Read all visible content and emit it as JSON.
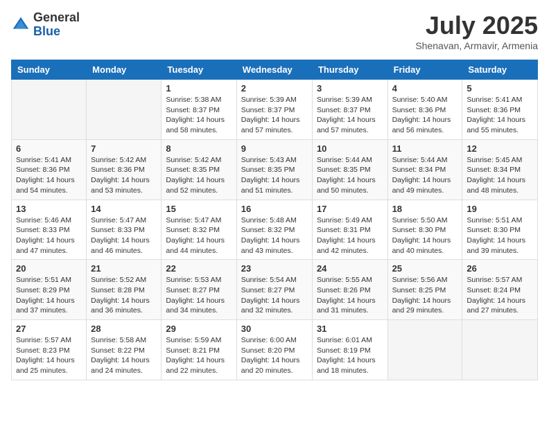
{
  "header": {
    "logo_general": "General",
    "logo_blue": "Blue",
    "title": "July 2025",
    "location": "Shenavan, Armavir, Armenia"
  },
  "calendar": {
    "headers": [
      "Sunday",
      "Monday",
      "Tuesday",
      "Wednesday",
      "Thursday",
      "Friday",
      "Saturday"
    ],
    "weeks": [
      [
        {
          "day": "",
          "info": ""
        },
        {
          "day": "",
          "info": ""
        },
        {
          "day": "1",
          "info": "Sunrise: 5:38 AM\nSunset: 8:37 PM\nDaylight: 14 hours and 58 minutes."
        },
        {
          "day": "2",
          "info": "Sunrise: 5:39 AM\nSunset: 8:37 PM\nDaylight: 14 hours and 57 minutes."
        },
        {
          "day": "3",
          "info": "Sunrise: 5:39 AM\nSunset: 8:37 PM\nDaylight: 14 hours and 57 minutes."
        },
        {
          "day": "4",
          "info": "Sunrise: 5:40 AM\nSunset: 8:36 PM\nDaylight: 14 hours and 56 minutes."
        },
        {
          "day": "5",
          "info": "Sunrise: 5:41 AM\nSunset: 8:36 PM\nDaylight: 14 hours and 55 minutes."
        }
      ],
      [
        {
          "day": "6",
          "info": "Sunrise: 5:41 AM\nSunset: 8:36 PM\nDaylight: 14 hours and 54 minutes."
        },
        {
          "day": "7",
          "info": "Sunrise: 5:42 AM\nSunset: 8:36 PM\nDaylight: 14 hours and 53 minutes."
        },
        {
          "day": "8",
          "info": "Sunrise: 5:42 AM\nSunset: 8:35 PM\nDaylight: 14 hours and 52 minutes."
        },
        {
          "day": "9",
          "info": "Sunrise: 5:43 AM\nSunset: 8:35 PM\nDaylight: 14 hours and 51 minutes."
        },
        {
          "day": "10",
          "info": "Sunrise: 5:44 AM\nSunset: 8:35 PM\nDaylight: 14 hours and 50 minutes."
        },
        {
          "day": "11",
          "info": "Sunrise: 5:44 AM\nSunset: 8:34 PM\nDaylight: 14 hours and 49 minutes."
        },
        {
          "day": "12",
          "info": "Sunrise: 5:45 AM\nSunset: 8:34 PM\nDaylight: 14 hours and 48 minutes."
        }
      ],
      [
        {
          "day": "13",
          "info": "Sunrise: 5:46 AM\nSunset: 8:33 PM\nDaylight: 14 hours and 47 minutes."
        },
        {
          "day": "14",
          "info": "Sunrise: 5:47 AM\nSunset: 8:33 PM\nDaylight: 14 hours and 46 minutes."
        },
        {
          "day": "15",
          "info": "Sunrise: 5:47 AM\nSunset: 8:32 PM\nDaylight: 14 hours and 44 minutes."
        },
        {
          "day": "16",
          "info": "Sunrise: 5:48 AM\nSunset: 8:32 PM\nDaylight: 14 hours and 43 minutes."
        },
        {
          "day": "17",
          "info": "Sunrise: 5:49 AM\nSunset: 8:31 PM\nDaylight: 14 hours and 42 minutes."
        },
        {
          "day": "18",
          "info": "Sunrise: 5:50 AM\nSunset: 8:30 PM\nDaylight: 14 hours and 40 minutes."
        },
        {
          "day": "19",
          "info": "Sunrise: 5:51 AM\nSunset: 8:30 PM\nDaylight: 14 hours and 39 minutes."
        }
      ],
      [
        {
          "day": "20",
          "info": "Sunrise: 5:51 AM\nSunset: 8:29 PM\nDaylight: 14 hours and 37 minutes."
        },
        {
          "day": "21",
          "info": "Sunrise: 5:52 AM\nSunset: 8:28 PM\nDaylight: 14 hours and 36 minutes."
        },
        {
          "day": "22",
          "info": "Sunrise: 5:53 AM\nSunset: 8:27 PM\nDaylight: 14 hours and 34 minutes."
        },
        {
          "day": "23",
          "info": "Sunrise: 5:54 AM\nSunset: 8:27 PM\nDaylight: 14 hours and 32 minutes."
        },
        {
          "day": "24",
          "info": "Sunrise: 5:55 AM\nSunset: 8:26 PM\nDaylight: 14 hours and 31 minutes."
        },
        {
          "day": "25",
          "info": "Sunrise: 5:56 AM\nSunset: 8:25 PM\nDaylight: 14 hours and 29 minutes."
        },
        {
          "day": "26",
          "info": "Sunrise: 5:57 AM\nSunset: 8:24 PM\nDaylight: 14 hours and 27 minutes."
        }
      ],
      [
        {
          "day": "27",
          "info": "Sunrise: 5:57 AM\nSunset: 8:23 PM\nDaylight: 14 hours and 25 minutes."
        },
        {
          "day": "28",
          "info": "Sunrise: 5:58 AM\nSunset: 8:22 PM\nDaylight: 14 hours and 24 minutes."
        },
        {
          "day": "29",
          "info": "Sunrise: 5:59 AM\nSunset: 8:21 PM\nDaylight: 14 hours and 22 minutes."
        },
        {
          "day": "30",
          "info": "Sunrise: 6:00 AM\nSunset: 8:20 PM\nDaylight: 14 hours and 20 minutes."
        },
        {
          "day": "31",
          "info": "Sunrise: 6:01 AM\nSunset: 8:19 PM\nDaylight: 14 hours and 18 minutes."
        },
        {
          "day": "",
          "info": ""
        },
        {
          "day": "",
          "info": ""
        }
      ]
    ]
  }
}
